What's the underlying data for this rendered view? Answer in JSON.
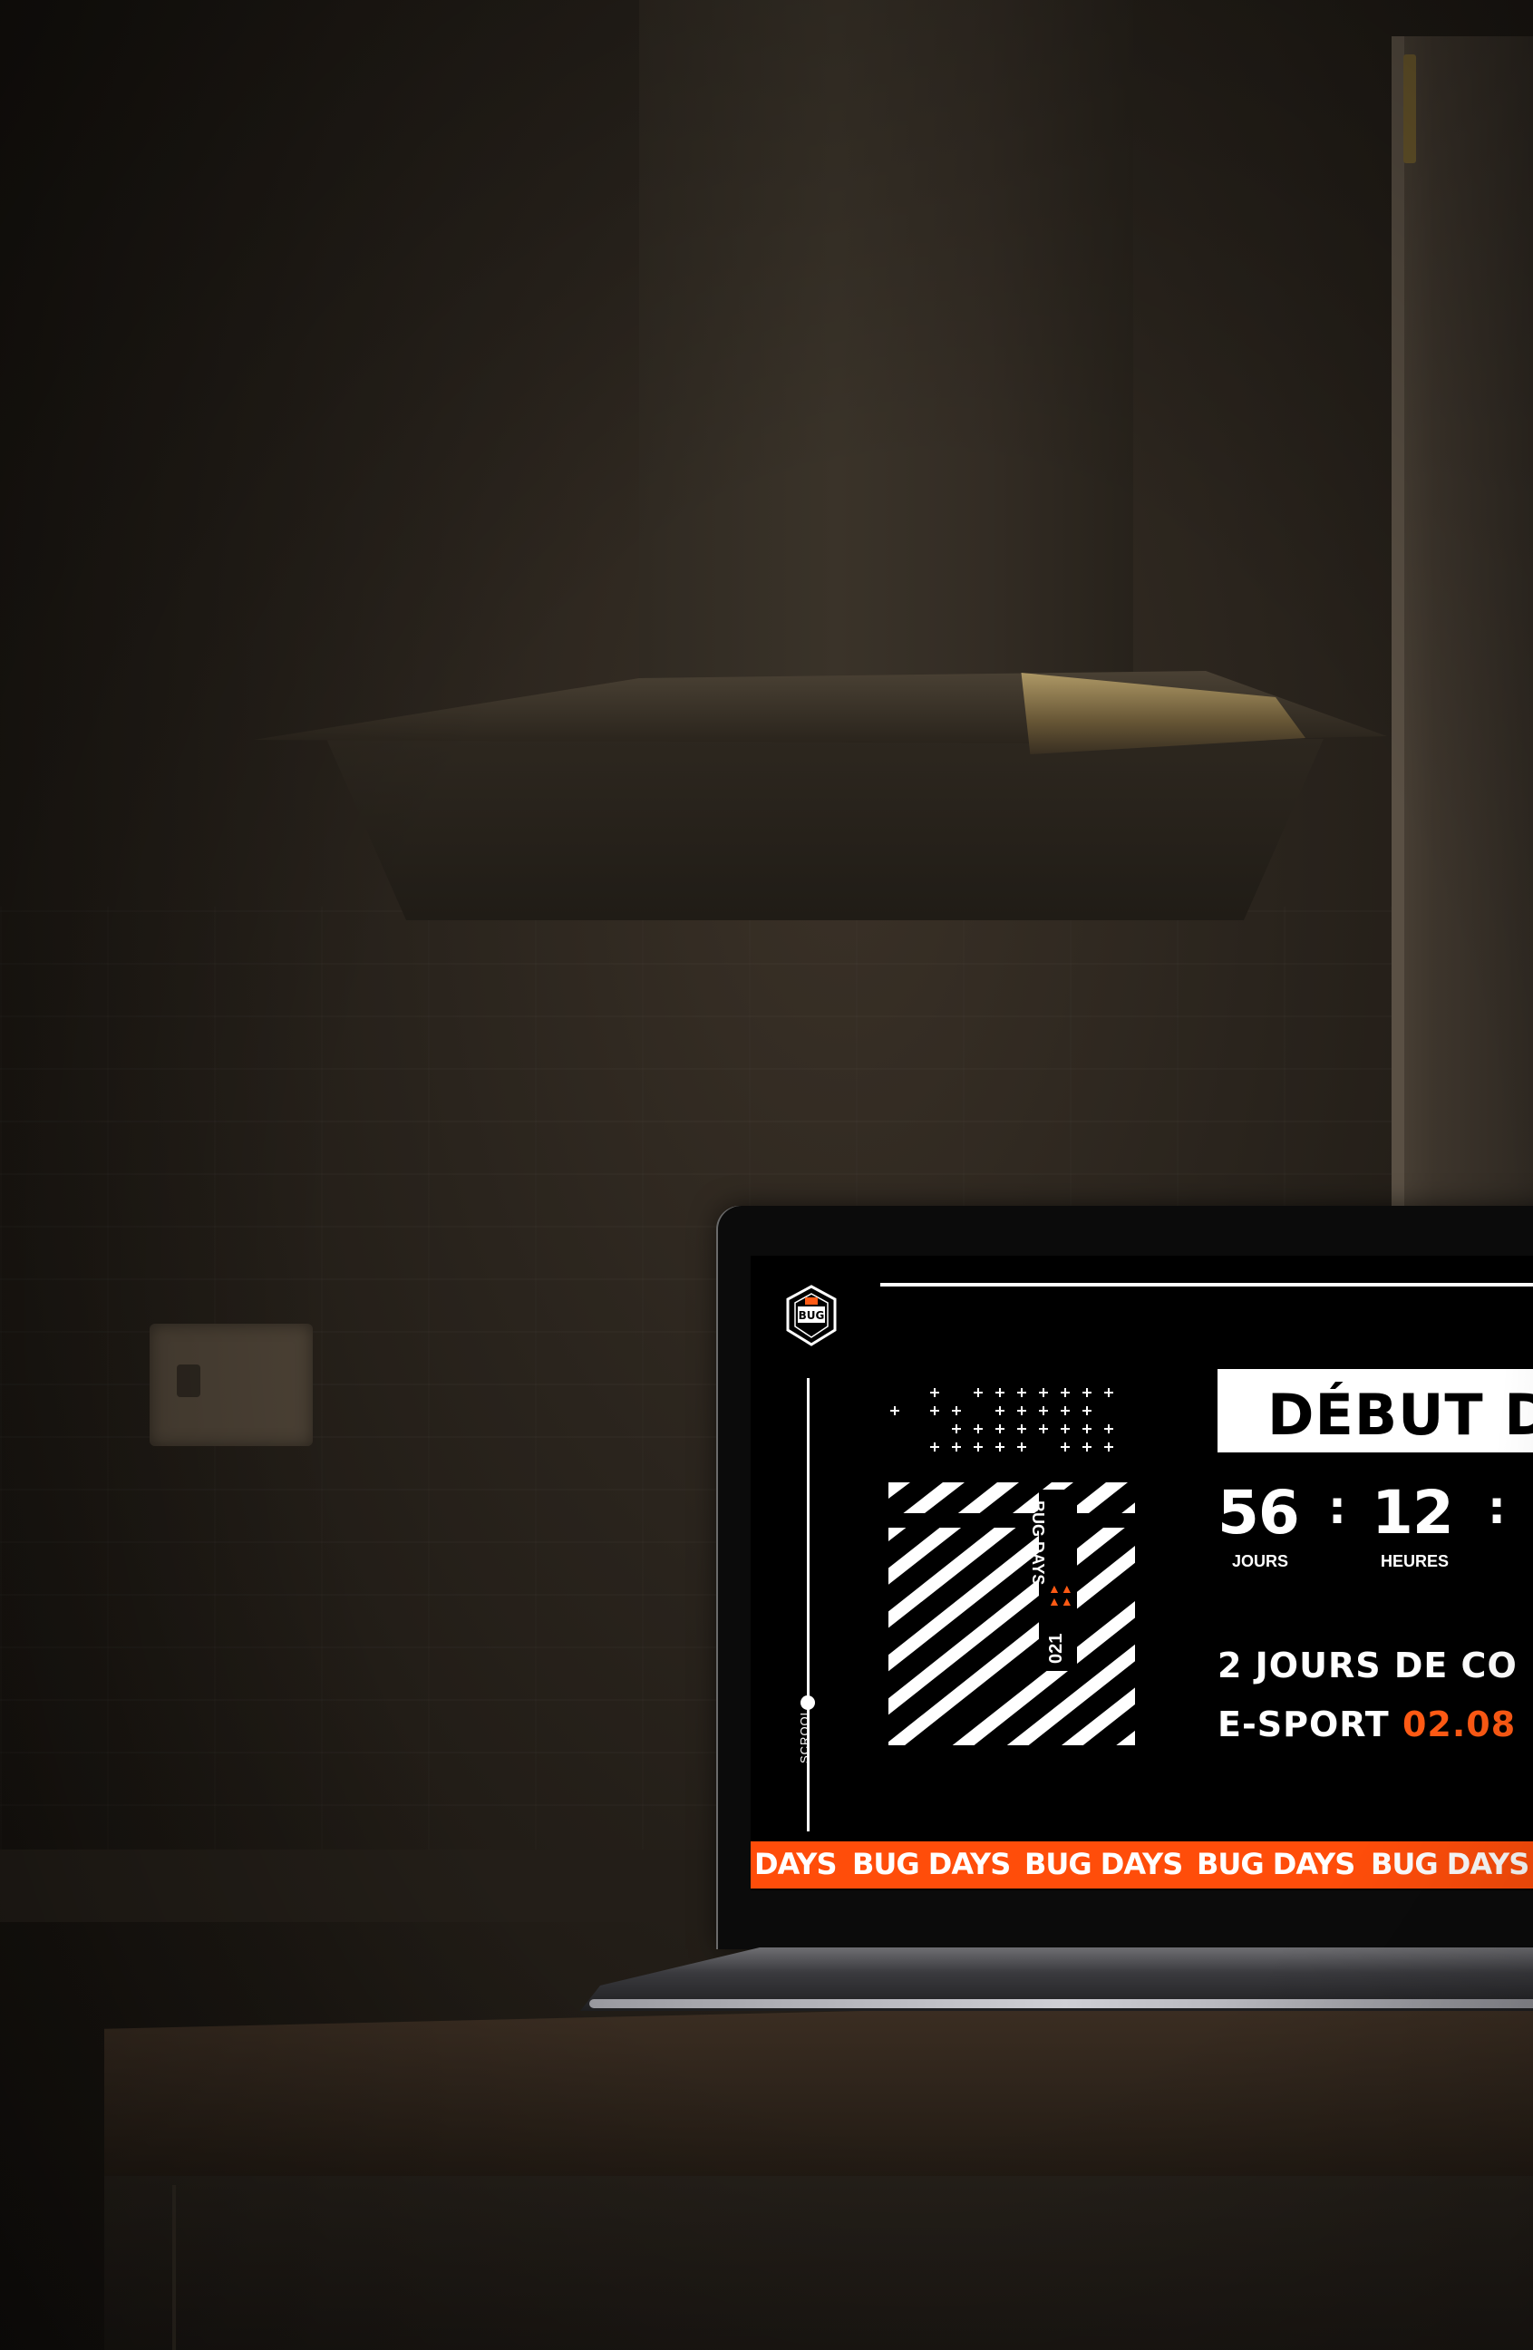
{
  "screen": {
    "logo_text": "BUG",
    "scroll_label": "SCROOL",
    "tag_title": "BUG DAYS",
    "tag_year": "021",
    "title": "DÉBUT D",
    "countdown": {
      "days_value": "56",
      "days_label": "JOURS",
      "hours_value": "12",
      "hours_label": "HEURES",
      "separator": ":"
    },
    "description_line1": "2 JOURS DE CO",
    "description_line2_prefix": "E-SPORT ",
    "description_line2_date": "02.08",
    "ticker": [
      "DAYS",
      "BUG DAYS",
      "BUG DAYS",
      "BUG DAYS",
      "BUG DAYS"
    ]
  },
  "colors": {
    "accent": "#ff4d0a",
    "screen_bg": "#000000",
    "text": "#ffffff"
  },
  "icons": {
    "logo": "bug-shield-logo-icon",
    "crosses": "plus-pattern-icon",
    "arrows": "chevron-up-icon"
  }
}
